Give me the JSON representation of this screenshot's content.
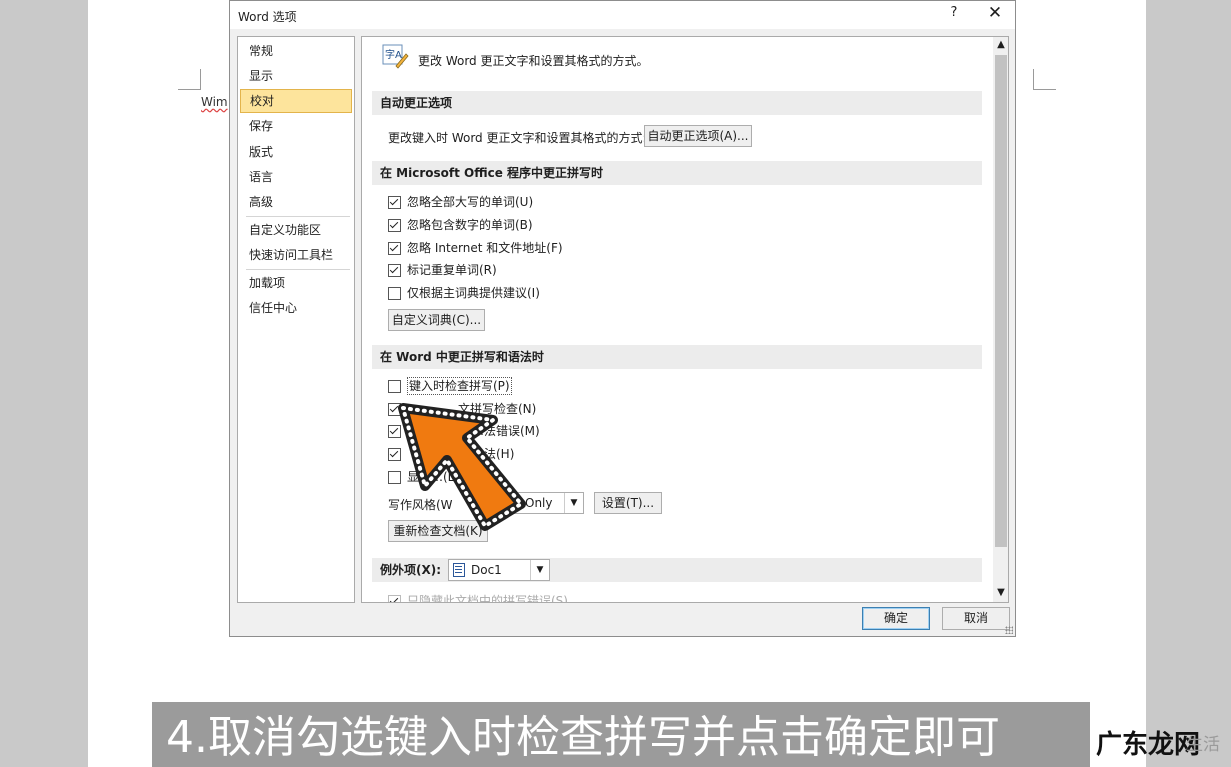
{
  "document": {
    "text": "Wim"
  },
  "dialog": {
    "title": "Word 选项",
    "help": "?",
    "close": "✕",
    "nav": [
      "常规",
      "显示",
      "校对",
      "保存",
      "版式",
      "语言",
      "高级",
      "自定义功能区",
      "快速访问工具栏",
      "加载项",
      "信任中心"
    ],
    "selected_nav": "校对",
    "header_text": "更改 Word 更正文字和设置其格式的方式。",
    "autocorrect": {
      "heading": "自动更正选项",
      "label": "更改键入时 Word 更正文字和设置其格式的方式:",
      "button": "自动更正选项(A)..."
    },
    "office": {
      "heading": "在 Microsoft Office 程序中更正拼写时",
      "items": [
        {
          "label": "忽略全部大写的单词(U)",
          "checked": true
        },
        {
          "label": "忽略包含数字的单词(B)",
          "checked": true
        },
        {
          "label": "忽略 Internet 和文件地址(F)",
          "checked": true
        },
        {
          "label": "标记重复单词(R)",
          "checked": true
        },
        {
          "label": "仅根据主词典提供建议(I)",
          "checked": false
        }
      ],
      "dict_button": "自定义词典(C)..."
    },
    "word": {
      "heading": "在 Word 中更正拼写和语法时",
      "items": [
        {
          "label": "键入时检查拼写(P)",
          "checked": false
        },
        {
          "label": "…文拼写检查(N)",
          "checked": true
        },
        {
          "label": "…法错误(M)",
          "checked": true
        },
        {
          "label": "…法(H)",
          "checked": true
        },
        {
          "label": "显示…(L)",
          "checked": false
        }
      ],
      "style_label": "写作风格(W",
      "style_value": "Only",
      "settings_button": "设置(T)...",
      "recheck_button": "重新检查文档(K)"
    },
    "exceptions": {
      "label": "例外项(X):",
      "doc": "Doc1",
      "dim_item": "只隐藏此文档中的拼写错误(S)"
    },
    "ok": "确定",
    "cancel": "取消"
  },
  "caption": "4.取消勾选键入时检查拼写并点击确定即可",
  "watermark": {
    "main": "广东龙网",
    "sub": "生活"
  },
  "colors": {
    "arrow": "#f07a10",
    "nav_selected": "#fde49c",
    "caption_bg": "#9b9b9b"
  }
}
